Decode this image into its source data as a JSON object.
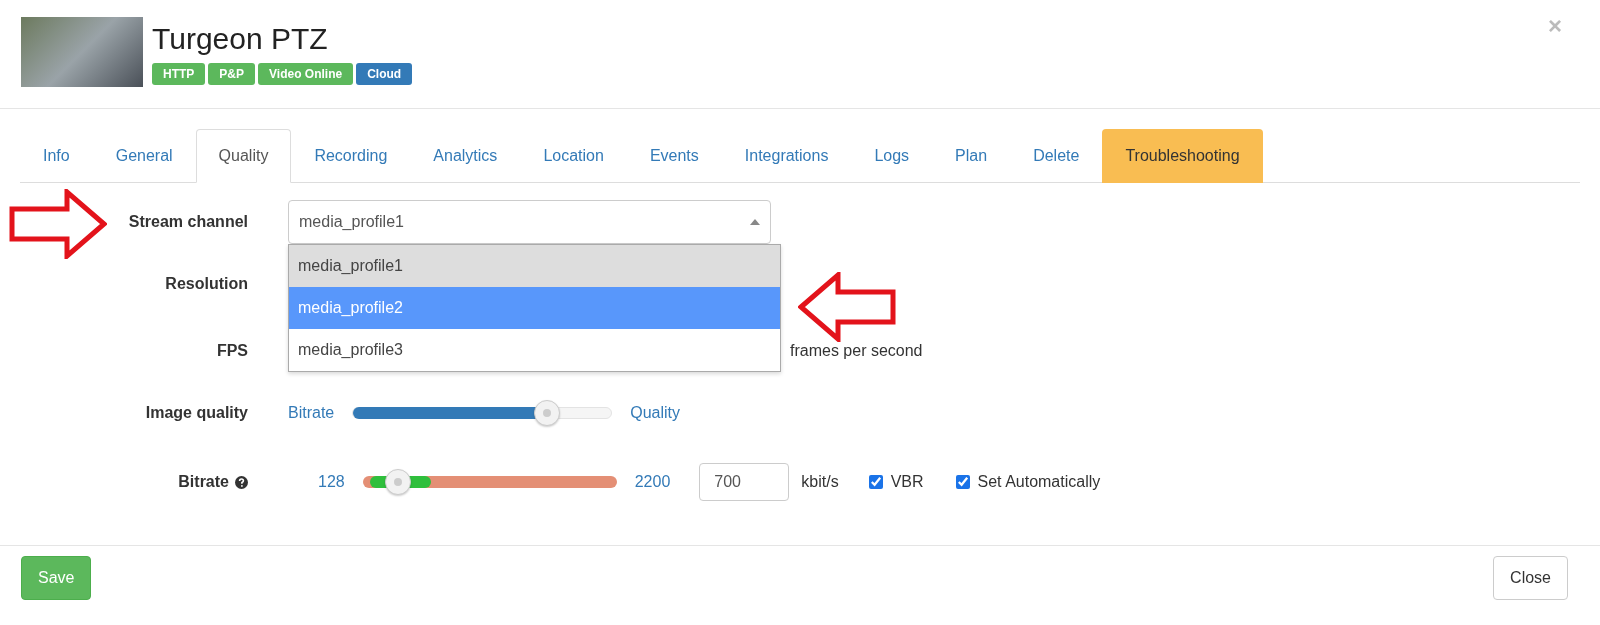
{
  "header": {
    "title": "Turgeon PTZ",
    "badges": [
      {
        "label": "HTTP",
        "color": "#5cb85c"
      },
      {
        "label": "P&P",
        "color": "#5cb85c"
      },
      {
        "label": "Video Online",
        "color": "#5cb85c"
      },
      {
        "label": "Cloud",
        "color": "#337ab7"
      }
    ],
    "close": "×"
  },
  "tabs": [
    {
      "label": "Info",
      "selected": false,
      "kind": "normal"
    },
    {
      "label": "General",
      "selected": false,
      "kind": "normal"
    },
    {
      "label": "Quality",
      "selected": true,
      "kind": "normal"
    },
    {
      "label": "Recording",
      "selected": false,
      "kind": "normal"
    },
    {
      "label": "Analytics",
      "selected": false,
      "kind": "normal"
    },
    {
      "label": "Location",
      "selected": false,
      "kind": "normal"
    },
    {
      "label": "Events",
      "selected": false,
      "kind": "normal"
    },
    {
      "label": "Integrations",
      "selected": false,
      "kind": "normal"
    },
    {
      "label": "Logs",
      "selected": false,
      "kind": "normal"
    },
    {
      "label": "Plan",
      "selected": false,
      "kind": "normal"
    },
    {
      "label": "Delete",
      "selected": false,
      "kind": "normal"
    },
    {
      "label": "Troubleshooting",
      "selected": false,
      "kind": "warning"
    }
  ],
  "stream_channel": {
    "label": "Stream channel",
    "value": "media_profile1",
    "expanded": true,
    "options": [
      {
        "label": "media_profile1",
        "selected": true,
        "highlighted": false
      },
      {
        "label": "media_profile2",
        "selected": false,
        "highlighted": true
      },
      {
        "label": "media_profile3",
        "selected": false,
        "highlighted": false
      }
    ]
  },
  "resolution": {
    "label": "Resolution"
  },
  "fps": {
    "label": "FPS",
    "unit": "frames per second"
  },
  "image_quality": {
    "label": "Image quality",
    "min_label": "Bitrate",
    "max_label": "Quality",
    "level": 0.75
  },
  "bitrate": {
    "label": "Bitrate",
    "min_label": "128",
    "max_label": "2200",
    "level": 0.14,
    "value": "700",
    "unit": "kbit/s",
    "checkboxes": [
      {
        "label": "VBR",
        "checked": true
      },
      {
        "label": "Set Automatically",
        "checked": true
      }
    ]
  },
  "footer": {
    "save": "Save",
    "close": "Close"
  }
}
